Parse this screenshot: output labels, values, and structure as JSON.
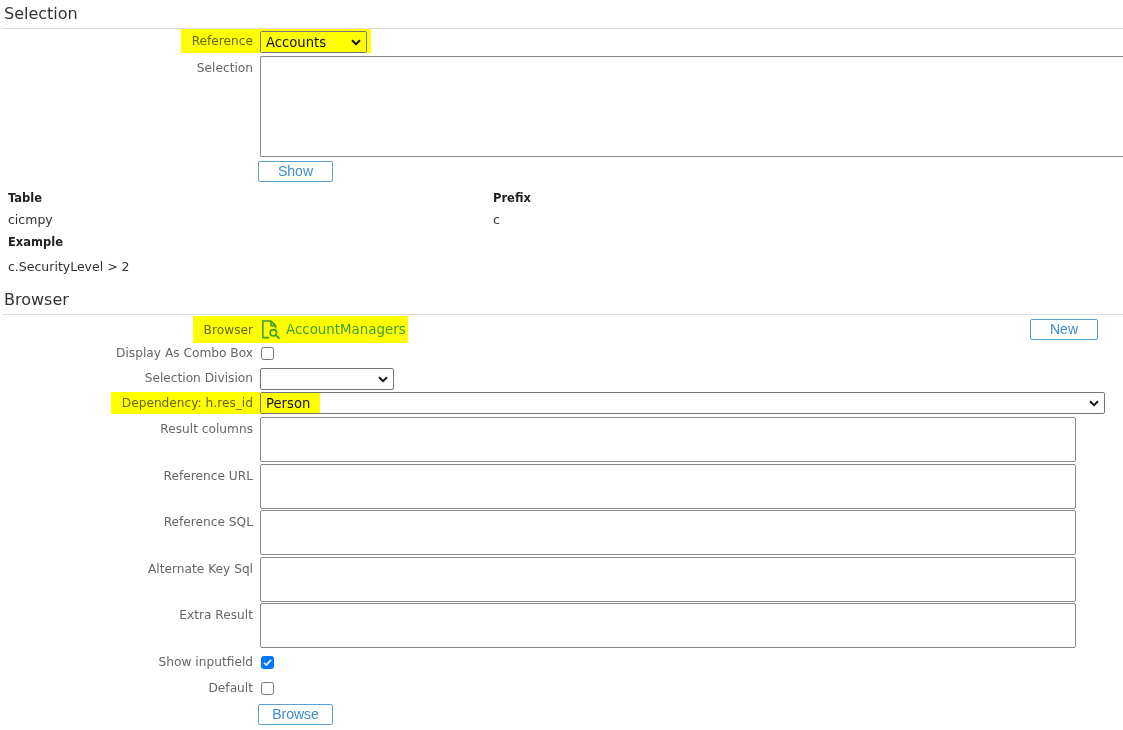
{
  "sections": [
    {
      "title": "Selection",
      "fields": [
        {
          "kind": "select",
          "label": "Reference",
          "value": "Accounts",
          "highlighted": true
        },
        {
          "kind": "textarea",
          "label": "Selection",
          "highlighted": false
        }
      ],
      "action_button": "Show",
      "info": [
        {
          "label": "Table",
          "value": "cicmpy"
        },
        {
          "label": "Prefix",
          "value": "c"
        },
        {
          "label": "Example",
          "value": "c.SecurityLevel > 2"
        }
      ]
    },
    {
      "title": "Browser",
      "fields": [
        {
          "kind": "link",
          "label": "Browser",
          "value": "AccountManagers",
          "highlighted": true,
          "button": "New"
        },
        {
          "kind": "checkbox",
          "label": "Display As Combo Box",
          "checked": false,
          "highlighted": false
        },
        {
          "kind": "select",
          "label": "Selection Division",
          "highlighted": false
        },
        {
          "kind": "select",
          "label": "Dependency: h.res_id",
          "value": "Person",
          "highlighted": true
        },
        {
          "kind": "textarea",
          "label": "Result columns",
          "highlighted": false
        },
        {
          "kind": "textarea",
          "label": "Reference URL",
          "highlighted": false
        },
        {
          "kind": "textarea",
          "label": "Reference SQL",
          "highlighted": false
        },
        {
          "kind": "textarea",
          "label": "Alternate Key Sql",
          "highlighted": false
        },
        {
          "kind": "textarea",
          "label": "Extra Result",
          "highlighted": false
        },
        {
          "kind": "checkbox",
          "label": "Show inputfield",
          "checked": true,
          "highlighted": false
        },
        {
          "kind": "checkbox",
          "label": "Default",
          "checked": false,
          "highlighted": false
        }
      ],
      "action_button": "Browse"
    }
  ]
}
